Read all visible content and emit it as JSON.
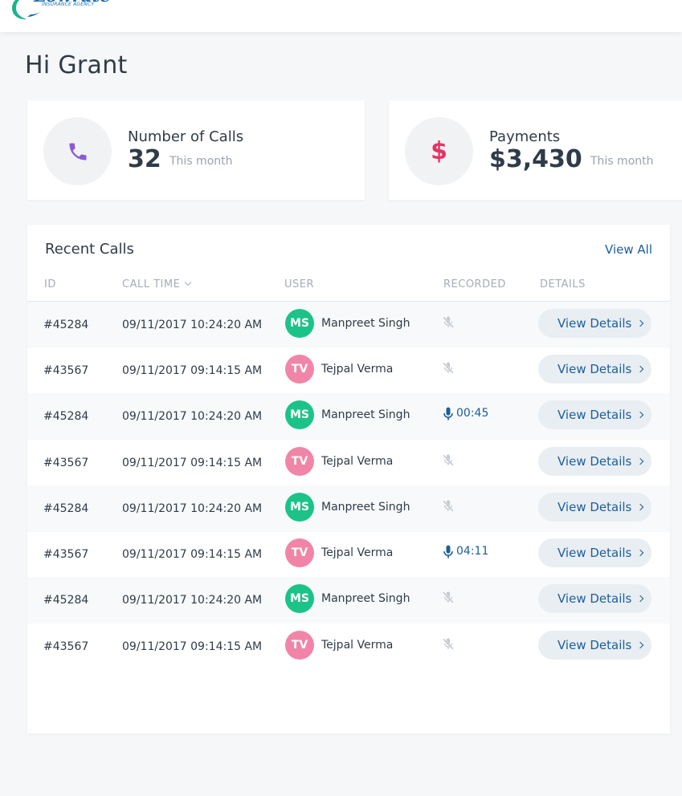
{
  "brand": {
    "name": "Lowrate",
    "tagline": "INSURANCE AGENCY",
    "color": "#1f6fb3"
  },
  "greeting": "Hi Grant",
  "stats": {
    "calls": {
      "icon": "phone-icon",
      "label": "Number of Calls",
      "value": "32",
      "period": "This month",
      "color": "#8a5bd6"
    },
    "payments": {
      "icon": "dollar-icon",
      "symbol": "$",
      "label": "Payments",
      "value": "$3,430",
      "period": "This month",
      "color": "#e63363"
    }
  },
  "recent_calls": {
    "title": "Recent Calls",
    "view_all": "View All",
    "columns": {
      "id": "ID",
      "call_time": "CALL TIME",
      "user": "USER",
      "recorded": "RECORDED",
      "details": "DETAILS"
    },
    "details_label": "View Details",
    "avatar_colors": {
      "MS": "#1cc389",
      "TV": "#f185a8"
    },
    "rows": [
      {
        "id": "#45284",
        "time": "09/11/2017 10:24:20 AM",
        "initials": "MS",
        "name": "Manpreet Singh",
        "recorded": false,
        "duration": ""
      },
      {
        "id": "#43567",
        "time": "09/11/2017 09:14:15 AM",
        "initials": "TV",
        "name": "Tejpal Verma",
        "recorded": false,
        "duration": ""
      },
      {
        "id": "#45284",
        "time": "09/11/2017 10:24:20 AM",
        "initials": "MS",
        "name": "Manpreet Singh",
        "recorded": true,
        "duration": "00:45"
      },
      {
        "id": "#43567",
        "time": "09/11/2017 09:14:15 AM",
        "initials": "TV",
        "name": "Tejpal Verma",
        "recorded": false,
        "duration": ""
      },
      {
        "id": "#45284",
        "time": "09/11/2017 10:24:20 AM",
        "initials": "MS",
        "name": "Manpreet Singh",
        "recorded": false,
        "duration": ""
      },
      {
        "id": "#43567",
        "time": "09/11/2017 09:14:15 AM",
        "initials": "TV",
        "name": "Tejpal Verma",
        "recorded": true,
        "duration": "04:11"
      },
      {
        "id": "#45284",
        "time": "09/11/2017 10:24:20 AM",
        "initials": "MS",
        "name": "Manpreet Singh",
        "recorded": false,
        "duration": ""
      },
      {
        "id": "#43567",
        "time": "09/11/2017 09:14:15 AM",
        "initials": "TV",
        "name": "Tejpal Verma",
        "recorded": false,
        "duration": ""
      }
    ]
  }
}
